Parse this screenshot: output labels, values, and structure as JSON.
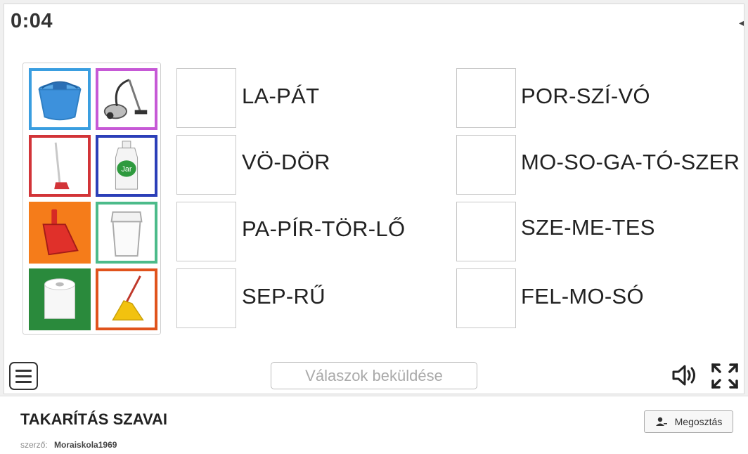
{
  "timer": "0:04",
  "tiles": [
    {
      "name": "bucket-image",
      "border": "#3a9ee0"
    },
    {
      "name": "vacuum-cleaner-image",
      "border": "#c659d6"
    },
    {
      "name": "broom-image",
      "border": "#d23438"
    },
    {
      "name": "dish-soap-image",
      "border": "#2b3fb8"
    },
    {
      "name": "dustpan-image",
      "border": "#f57c1a"
    },
    {
      "name": "trash-bin-image",
      "border": "#4cbb8a"
    },
    {
      "name": "paper-towel-image",
      "border": "#2a8a3c"
    },
    {
      "name": "mop-image",
      "border": "#e0531c"
    }
  ],
  "words_left": [
    "LA-PÁT",
    "VÖ-DÖR",
    "PA-PÍR-TÖR-LŐ",
    "SEP-RŰ"
  ],
  "words_right": [
    "POR-SZÍ-VÓ",
    "MO-SO-GA-TÓ-SZER",
    "SZE-ME-TES",
    "FEL-MO-SÓ"
  ],
  "submit_label": "Válaszok beküldése",
  "activity_title": "TAKARÍTÁS SZAVAI",
  "author_label": "szerző:",
  "author_name": "Moraiskola1969",
  "share_label": "Megosztás",
  "icons": {
    "menu": "menu-icon",
    "sound": "speaker-icon",
    "fullscreen": "fullscreen-icon",
    "share": "user-icon"
  }
}
